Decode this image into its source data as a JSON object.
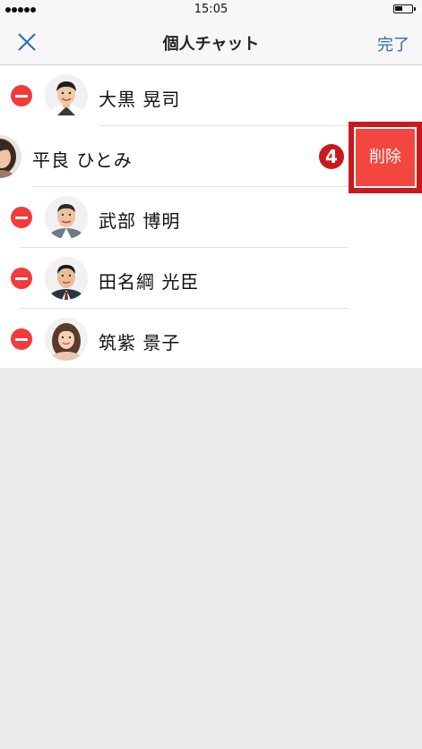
{
  "status": {
    "time": "15:05"
  },
  "nav": {
    "title": "個人チャット",
    "done_label": "完了",
    "close_icon": "close-icon"
  },
  "contacts": [
    {
      "name": "大黒 晃司",
      "avatar": "man-smiling"
    },
    {
      "name": "平良 ひとみ",
      "avatar": "woman-portrait",
      "swiped": true
    },
    {
      "name": "武部 博明",
      "avatar": "man-older"
    },
    {
      "name": "田名綱 光臣",
      "avatar": "man-suit"
    },
    {
      "name": "筑紫 景子",
      "avatar": "woman-young"
    }
  ],
  "swipe_action": {
    "delete_label": "削除",
    "step_number": "4"
  },
  "colors": {
    "accent": "#2d6bb6",
    "delete": "#f3463f",
    "minus": "#f23b3b",
    "annotation": "#c8191f"
  }
}
